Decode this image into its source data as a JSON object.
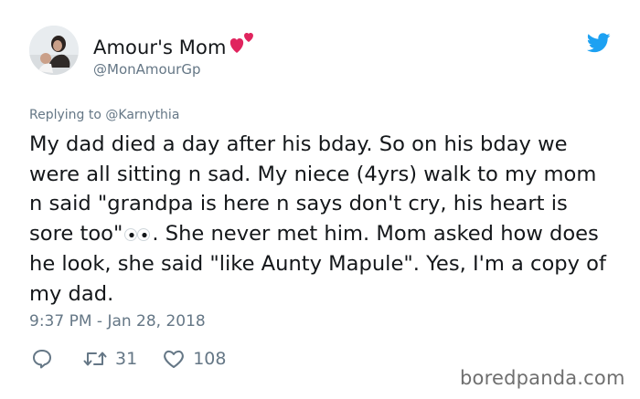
{
  "author": {
    "display_name": "Amour's Mom",
    "handle": "@MonAmourGp",
    "avatar_icon": "profile-photo",
    "name_emoji": "two-hearts-icon"
  },
  "reply": {
    "prefix": "Replying to ",
    "mention": "@Karnythia"
  },
  "tweet": {
    "text_part1": "My dad died a day after his bday. So on his bday we were all sitting n sad. My niece (4yrs) walk to my mom n said \"grandpa is here n says don't cry, his heart is sore too\"",
    "text_part2": ". She never met him. Mom asked how does he look, she said \"like Aunty Mapule\". Yes, I'm a copy of my dad.",
    "inline_emoji": "eyes-icon",
    "timestamp": "9:37 PM - Jan 28, 2018"
  },
  "actions": {
    "reply_icon": "comment-bubble-icon",
    "retweets": "31",
    "likes": "108"
  },
  "watermark": "boredpanda.com",
  "colors": {
    "text": "#14171a",
    "muted": "#657786",
    "twitter_blue": "#1da1f2",
    "heart_pink": "#e0245e"
  }
}
